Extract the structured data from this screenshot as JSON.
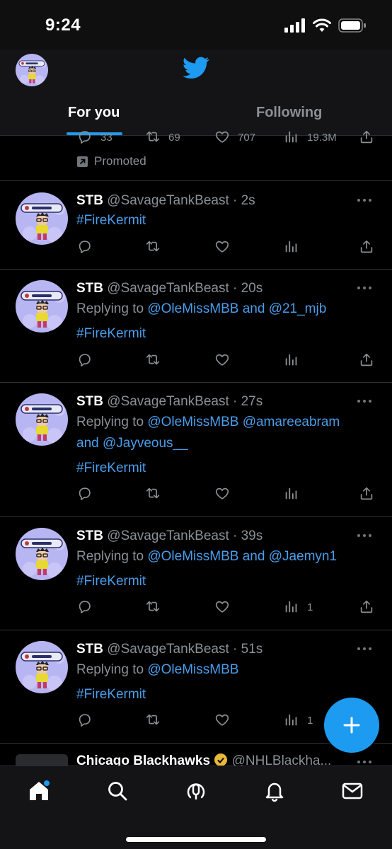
{
  "status_bar": {
    "time": "9:24"
  },
  "header": {
    "logo_icon": "twitter-bird-icon",
    "tabs": [
      {
        "label": "For you",
        "active": true
      },
      {
        "label": "Following",
        "active": false
      }
    ]
  },
  "promoted": {
    "reply_count": "33",
    "retweet_count": "69",
    "like_count": "707",
    "view_count": "19.3M",
    "label": "Promoted"
  },
  "tweets": [
    {
      "name": "STB",
      "handle": "@SavageTankBeast · 2s",
      "hashtag": "#FireKermit",
      "views": ""
    },
    {
      "name": "STB",
      "handle": "@SavageTankBeast · 20s",
      "reply_prefix": "Replying to ",
      "reply_to_1": "@OleMissMBB",
      "reply_mid": " and ",
      "reply_to_2": "@21_mjb",
      "hashtag": "#FireKermit",
      "views": ""
    },
    {
      "name": "STB",
      "handle": "@SavageTankBeast · 27s",
      "reply_prefix": "Replying to ",
      "reply_to_1": "@OleMissMBB @amareeabram",
      "reply_line2": "and @Jayveous__",
      "hashtag": "#FireKermit",
      "views": ""
    },
    {
      "name": "STB",
      "handle": "@SavageTankBeast · 39s",
      "reply_prefix": "Replying to ",
      "reply_to_1": "@OleMissMBB",
      "reply_mid": " and ",
      "reply_to_2": "@Jaemyn1",
      "hashtag": "#FireKermit",
      "views": "1"
    },
    {
      "name": "STB",
      "handle": "@SavageTankBeast · 51s",
      "reply_prefix": "Replying to ",
      "reply_to_1": "@OleMissMBB",
      "hashtag": "#FireKermit",
      "views": "1"
    }
  ],
  "next_tweet": {
    "name": "Chicago Blackhawks",
    "handle": "@NHLBlackha..."
  },
  "colors": {
    "accent": "#1d9bf0",
    "link": "#4a9dea",
    "muted": "#8b9096",
    "background": "#000000"
  }
}
